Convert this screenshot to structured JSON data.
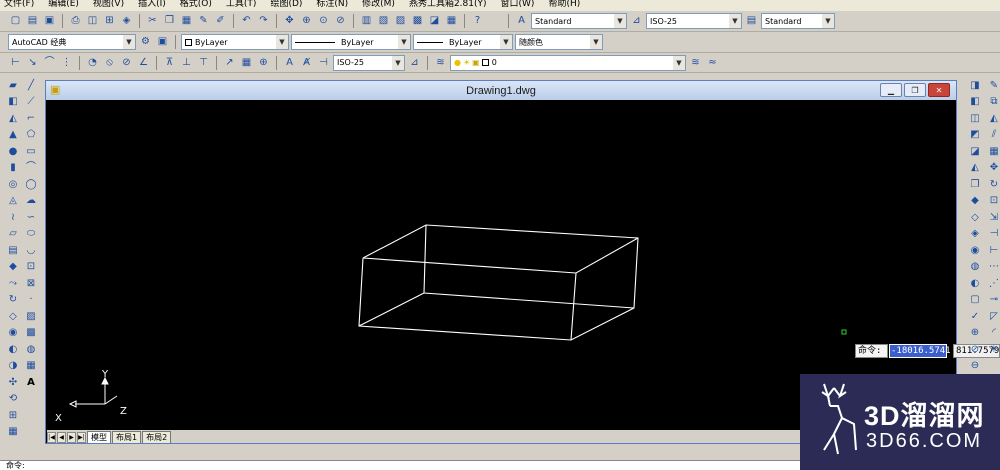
{
  "menu": [
    "文件(F)",
    "编辑(E)",
    "视图(V)",
    "插入(I)",
    "格式(O)",
    "工具(T)",
    "绘图(D)",
    "标注(N)",
    "修改(M)",
    "燕秀工具箱2.81(Y)",
    "窗口(W)",
    "帮助(H)"
  ],
  "toolbar1": {
    "text_style": "Standard",
    "dim_style": "ISO-25",
    "table_style": "Standard"
  },
  "toolbar2": {
    "workspace": "AutoCAD 经典",
    "color": "ByLayer",
    "linetype": "ByLayer",
    "lineweight": "ByLayer",
    "plot_style": "随颜色"
  },
  "toolbar3": {
    "dim_style": "ISO-25",
    "layer": "0"
  },
  "drawing_window": {
    "title": "Drawing1.dwg"
  },
  "ucs": {
    "y": "Y",
    "x": "X",
    "z": "Z"
  },
  "layout_tabs": [
    "模型",
    "布局1",
    "布局2"
  ],
  "dynamic_input": {
    "label": "命令:",
    "x_value": "-18016.5741",
    "y_value": "811.7579"
  },
  "command_line": {
    "prompt": "命令:"
  },
  "watermark": {
    "big": "3D溜溜网",
    "small": "3D66.COM"
  },
  "colors": {
    "canvas": "#000000",
    "wireframe": "#ffffff",
    "highlight": "#3a5fcd",
    "watermark_bg": "#2b2b55"
  }
}
